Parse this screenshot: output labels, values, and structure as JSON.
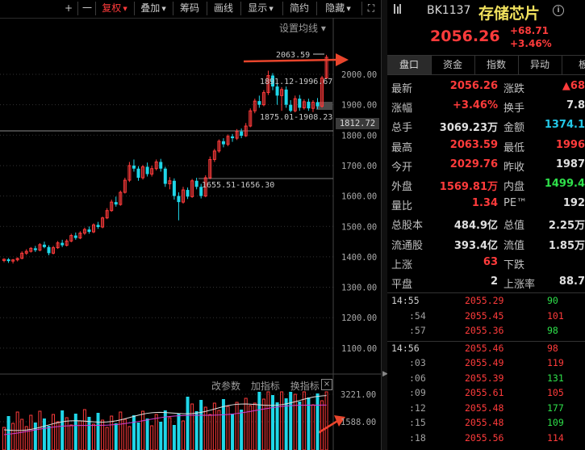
{
  "toolbar": {
    "items": [
      "+",
      "一",
      "复权",
      "叠加",
      "筹码",
      "画线",
      "显示",
      "简约",
      "隐藏",
      "⛶"
    ],
    "active": "复权"
  },
  "chart": {
    "ma_setting": "设置均线",
    "price_axis": [
      "2000.00",
      "1900.00",
      "1800.00",
      "1700.00",
      "1600.00",
      "1500.00",
      "1400.00",
      "1300.00",
      "1200.00",
      "1100.00"
    ],
    "current_price_tag": "1812.72",
    "annotations": {
      "high": "2063.59",
      "range1": "1891.12-1996.67",
      "range2": "1875.01-1908.23",
      "range3": "1655.51-1656.30"
    },
    "volume_tools": [
      "改参数",
      "加指标",
      "换指标"
    ],
    "volume_close": "×",
    "volume_axis": [
      "3221.00",
      "1588.00"
    ]
  },
  "header": {
    "code": "BK1137",
    "name": "存储芯片",
    "info_icon": "ⓘ",
    "price": "2056.26",
    "change": "+68.71",
    "change_pct": "+3.46%"
  },
  "tabs": [
    "盘口",
    "资金",
    "指数",
    "异动",
    "板"
  ],
  "quote": [
    {
      "l1": "最新",
      "v1": "2056.26",
      "c1": "red",
      "l2": "涨跌",
      "v2": "▲68",
      "c2": "red"
    },
    {
      "l1": "涨幅",
      "v1": "+3.46%",
      "c1": "red",
      "l2": "换手",
      "v2": "7.8",
      "c2": "wht"
    },
    {
      "l1": "总手",
      "v1": "3069.23万",
      "c1": "wht",
      "l2": "金额",
      "v2": "1374.1",
      "c2": "cyn"
    },
    {
      "l1": "最高",
      "v1": "2063.59",
      "c1": "red",
      "l2": "最低",
      "v2": "1996",
      "c2": "red"
    },
    {
      "l1": "今开",
      "v1": "2029.76",
      "c1": "red",
      "l2": "昨收",
      "v2": "1987",
      "c2": "wht"
    },
    {
      "l1": "外盘",
      "v1": "1569.81万",
      "c1": "red",
      "l2": "内盘",
      "v2": "1499.4",
      "c2": "grn"
    },
    {
      "l1": "量比",
      "v1": "1.34",
      "c1": "red",
      "l2": "PE™",
      "v2": "192",
      "c2": "wht"
    },
    {
      "l1": "总股本",
      "v1": "484.9亿",
      "c1": "wht",
      "l2": "总值",
      "v2": "2.25万",
      "c2": "wht"
    },
    {
      "l1": "流通股",
      "v1": "393.4亿",
      "c1": "wht",
      "l2": "流值",
      "v2": "1.85万",
      "c2": "wht"
    },
    {
      "l1": "上涨",
      "v1": "63",
      "c1": "red",
      "l2": "下跌",
      "v2": "",
      "c2": "grn"
    },
    {
      "l1": "平盘",
      "v1": "2",
      "c1": "wht",
      "l2": "上涨率",
      "v2": "88.7",
      "c2": "wht"
    }
  ],
  "ticks": [
    {
      "time": "14:55",
      "sub": false,
      "price": "2055.29",
      "vol": "90",
      "c": "grn"
    },
    {
      "time": ":54",
      "sub": true,
      "price": "2055.45",
      "vol": "101",
      "c": "red"
    },
    {
      "time": ":57",
      "sub": true,
      "price": "2055.36",
      "vol": "98",
      "c": "grn"
    },
    {
      "time": "14:56",
      "sub": false,
      "price": "2055.46",
      "vol": "98",
      "c": "red"
    },
    {
      "time": ":03",
      "sub": true,
      "price": "2055.49",
      "vol": "119",
      "c": "red"
    },
    {
      "time": ":06",
      "sub": true,
      "price": "2055.39",
      "vol": "131",
      "c": "grn"
    },
    {
      "time": ":09",
      "sub": true,
      "price": "2055.61",
      "vol": "105",
      "c": "red"
    },
    {
      "time": ":12",
      "sub": true,
      "price": "2055.48",
      "vol": "177",
      "c": "grn"
    },
    {
      "time": ":15",
      "sub": true,
      "price": "2055.48",
      "vol": "109",
      "c": "grn"
    },
    {
      "time": ":18",
      "sub": true,
      "price": "2055.56",
      "vol": "114",
      "c": "red"
    }
  ],
  "colors": {
    "up": "#ff3b3b",
    "down": "#1fd6e8",
    "name": "#f2e25e",
    "arrow": "#e8452c"
  }
}
